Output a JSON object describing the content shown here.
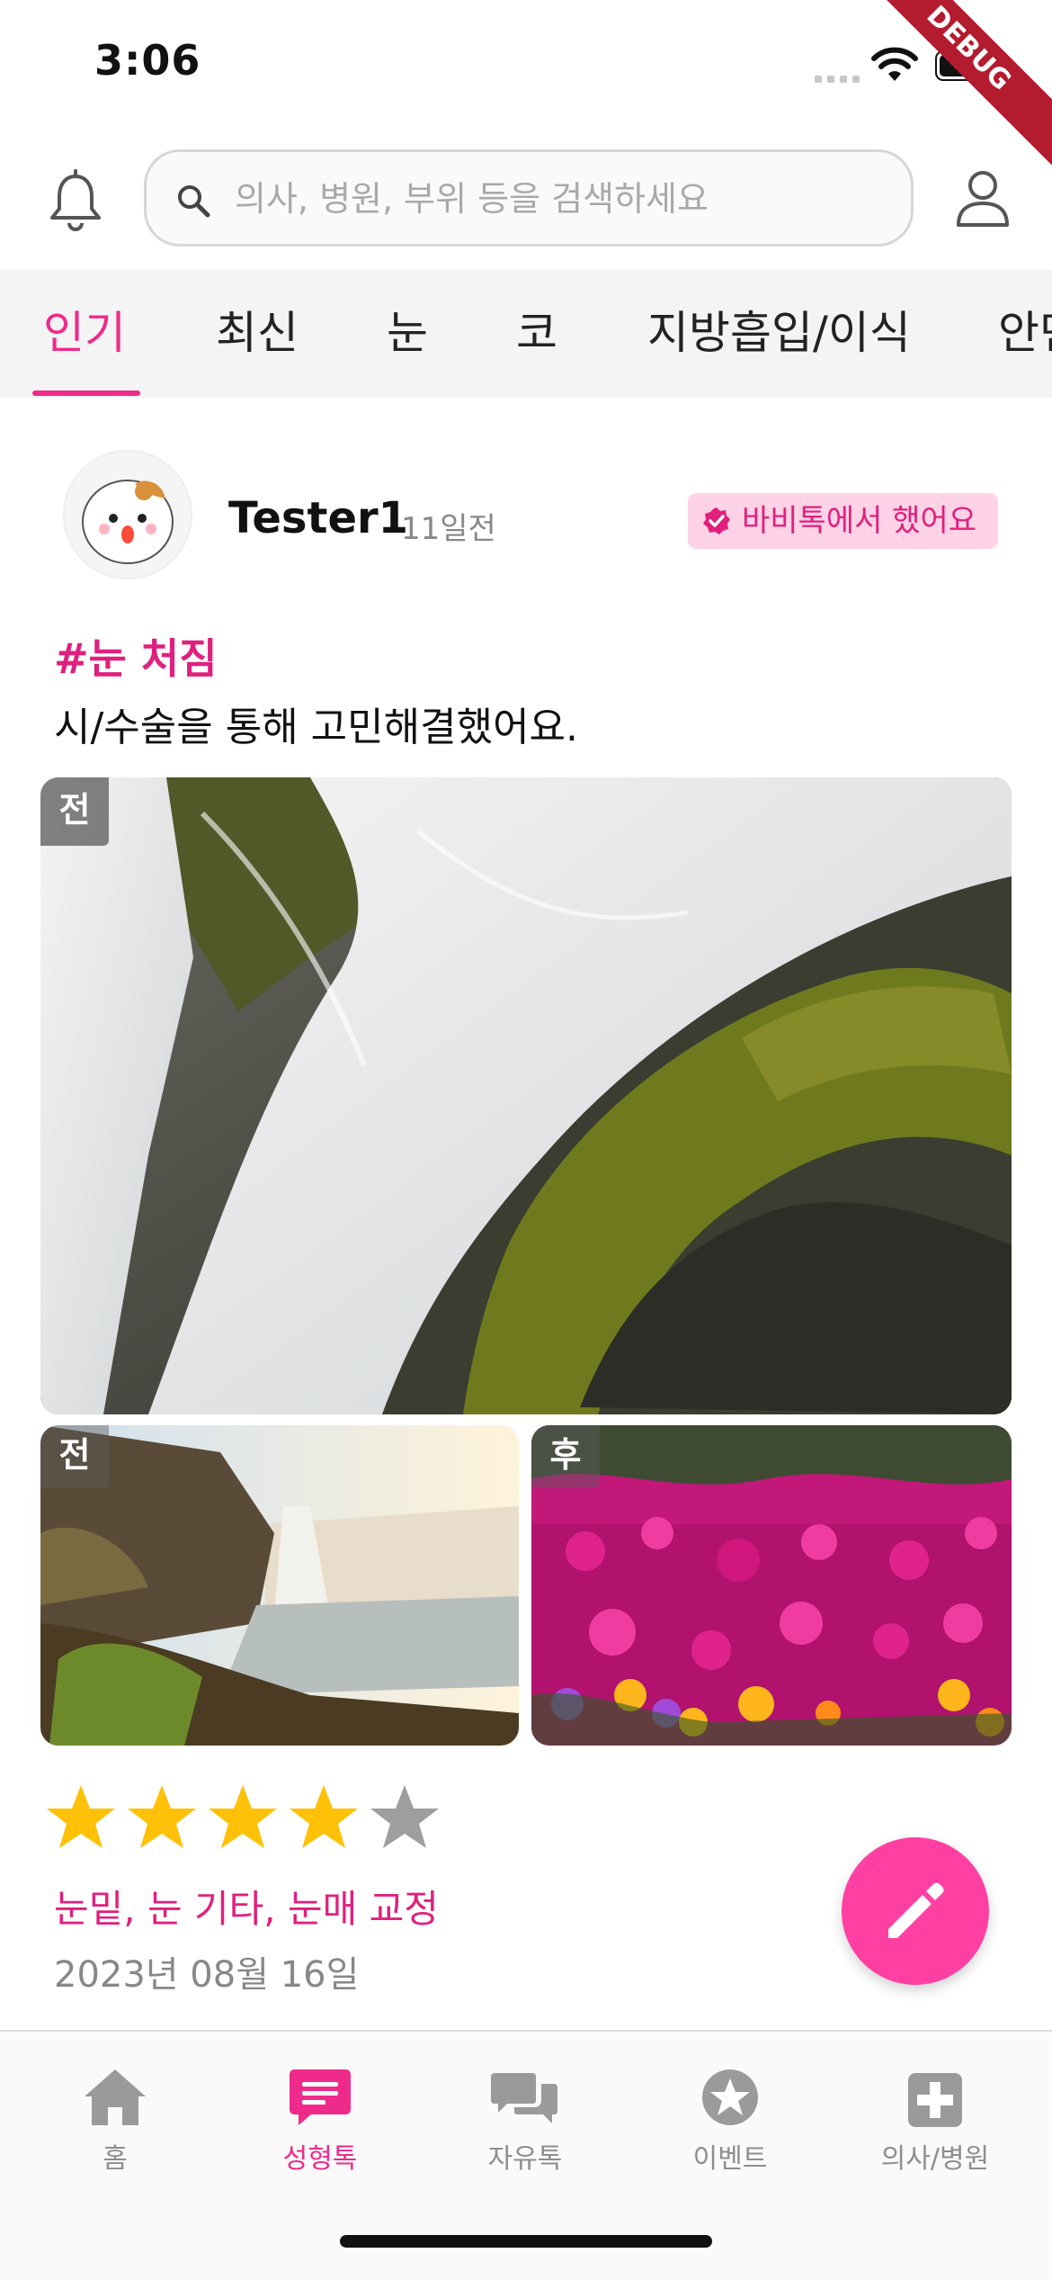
{
  "status_bar": {
    "time": "3:06",
    "debug_banner": "DEBUG"
  },
  "search": {
    "placeholder": "의사, 병원, 부위 등을 검색하세요"
  },
  "tabs": [
    {
      "label": "인기",
      "active": true
    },
    {
      "label": "최신"
    },
    {
      "label": "눈"
    },
    {
      "label": "코"
    },
    {
      "label": "지방흡입/이식"
    },
    {
      "label": "안면"
    }
  ],
  "post": {
    "username": "Tester1",
    "time_ago": "11일전",
    "badge": "바비톡에서 했어요",
    "hashtag": "#눈 처짐",
    "text": "시/수술을 통해 고민해결했어요.",
    "photos": [
      {
        "label": "전",
        "subject": "waterfall over mossy rocks"
      },
      {
        "label": "전",
        "subject": "waterfall at sunrise"
      },
      {
        "label": "후",
        "subject": "pink flower field"
      }
    ],
    "rating": {
      "value": 4,
      "max": 5
    },
    "tags": "눈밑, 눈 기타, 눈매 교정",
    "date": "2023년 08월 16일"
  },
  "colors": {
    "accent": "#ee2b8a",
    "fab": "#ff3fa2",
    "star": "#ffc107"
  },
  "bottom_nav": [
    {
      "label": "홈",
      "icon": "home-icon"
    },
    {
      "label": "성형톡",
      "icon": "chat-icon",
      "active": true
    },
    {
      "label": "자유톡",
      "icon": "chats-icon"
    },
    {
      "label": "이벤트",
      "icon": "star-circle-icon"
    },
    {
      "label": "의사/병원",
      "icon": "plus-square-icon"
    }
  ]
}
